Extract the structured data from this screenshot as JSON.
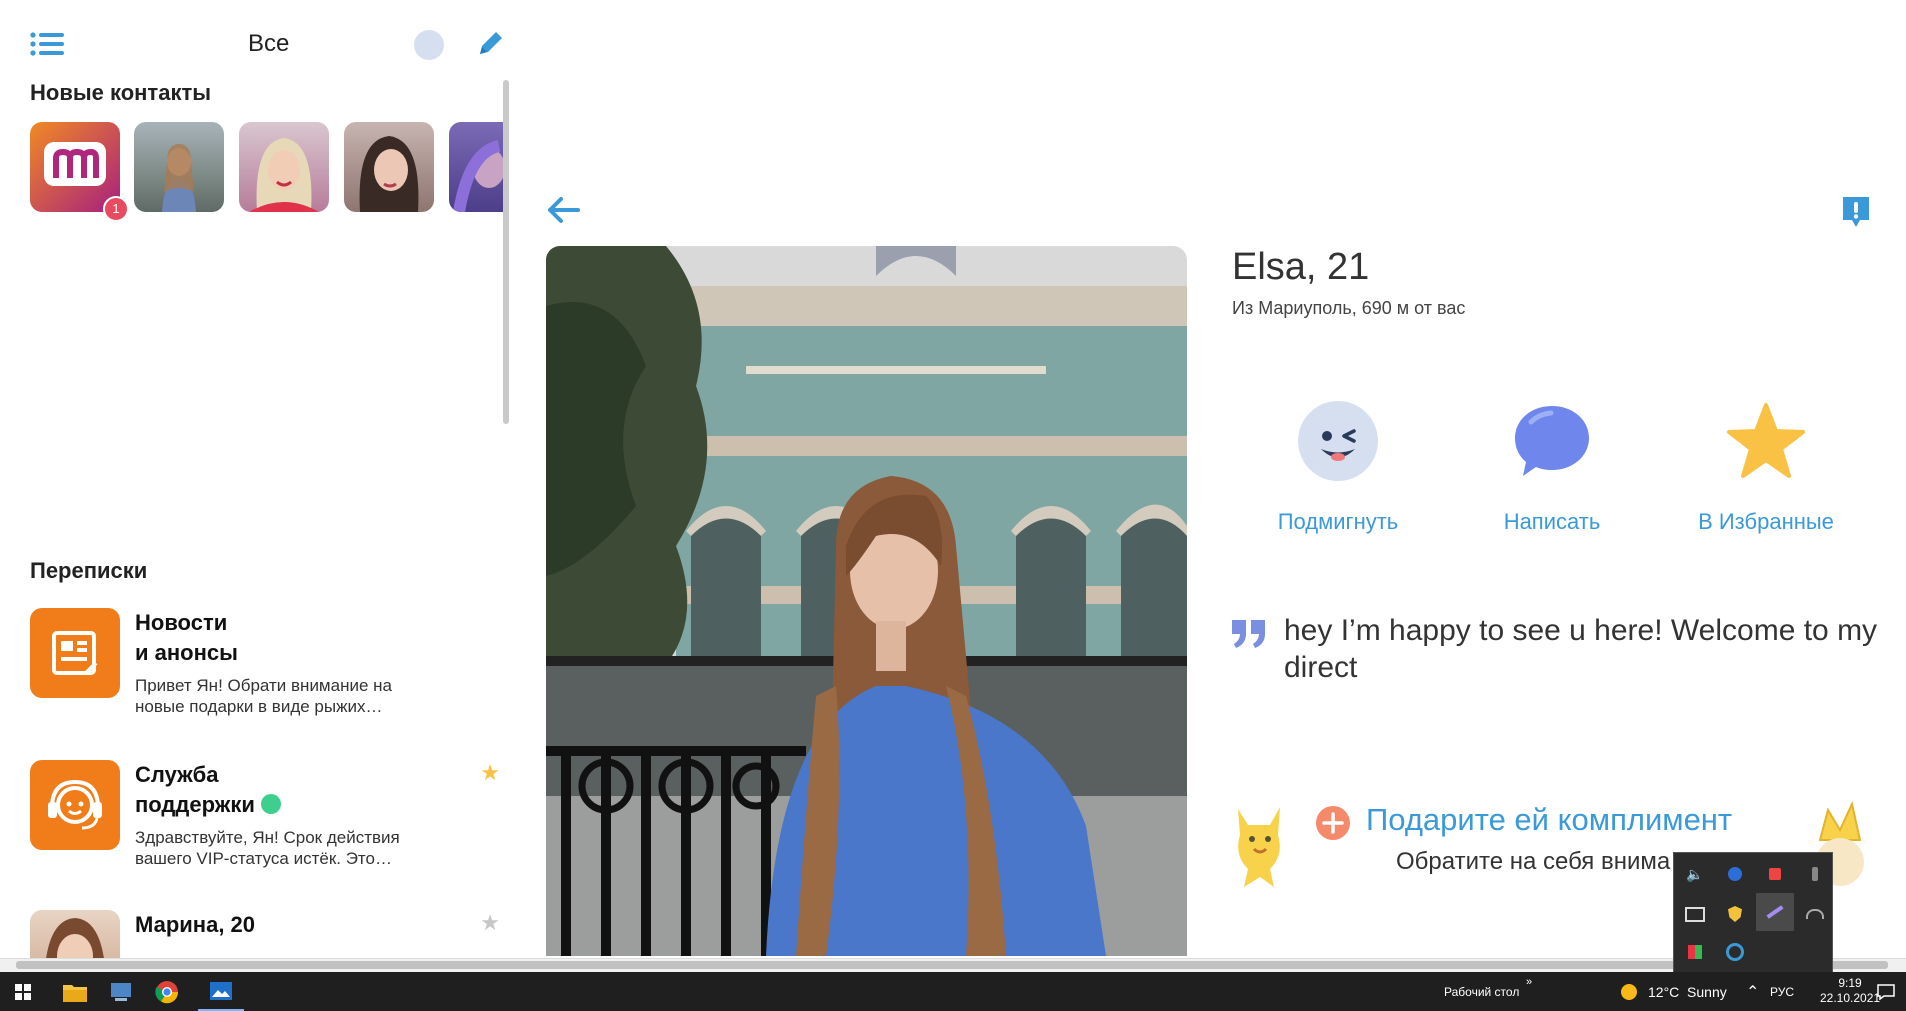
{
  "sidebar": {
    "filter_label": "Все",
    "new_contacts_heading": "Новые контакты",
    "new_contacts_badge": "1",
    "conversations_heading": "Переписки",
    "conversations": [
      {
        "title_line1": "Новости",
        "title_line2": "и анонсы",
        "snippet_line1": "Привет Ян! Обрати внимание на",
        "snippet_line2": "новые подарки в виде рыжих…",
        "starred": false
      },
      {
        "title_line1": "Служба",
        "title_line2": "поддержки",
        "snippet_line1": "Здравствуйте, Ян! Срок действия",
        "snippet_line2": "вашего VIP-статуса истёк. Это…",
        "starred": true
      },
      {
        "title_line1": "Марина, 20",
        "starred": false
      }
    ]
  },
  "profile": {
    "name_age": "Elsa, 21",
    "location": "Из Мариуполь, 690 м от вас",
    "actions": [
      {
        "label": "Подмигнуть",
        "icon": "wink-face-icon"
      },
      {
        "label": "Написать",
        "icon": "chat-bubble-icon"
      },
      {
        "label": "В Избранные",
        "icon": "star-icon"
      }
    ],
    "quote": "hey I’m happy to see u here! Welcome to my direct",
    "compliment_title": "Подарите ей комплимент",
    "compliment_subtitle": "Обратите на себя внима"
  },
  "taskbar": {
    "desktop_label": "Рабочий стол",
    "weather": "12°C  Sunny",
    "language": "РУС",
    "time": "9:19",
    "date": "22.10.2021"
  },
  "colors": {
    "accent_blue": "#3a9ad9",
    "orange": "#f07d1a",
    "badge_red": "#e84a5f",
    "online_green": "#3ecf8e",
    "star_gold": "#f9c244"
  }
}
